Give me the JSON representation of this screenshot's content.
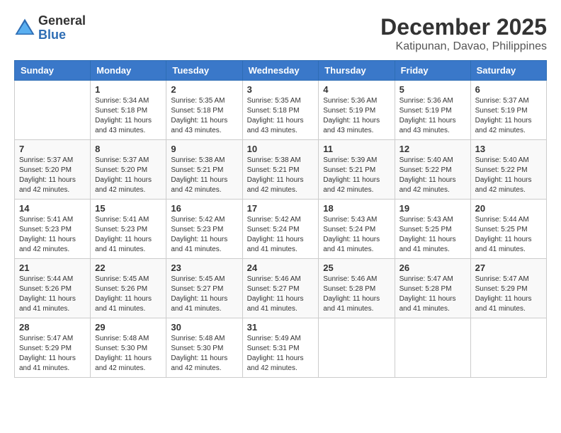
{
  "header": {
    "logo_general": "General",
    "logo_blue": "Blue",
    "month_year": "December 2025",
    "location": "Katipunan, Davao, Philippines"
  },
  "days_of_week": [
    "Sunday",
    "Monday",
    "Tuesday",
    "Wednesday",
    "Thursday",
    "Friday",
    "Saturday"
  ],
  "weeks": [
    [
      {
        "day": "",
        "info": ""
      },
      {
        "day": "1",
        "info": "Sunrise: 5:34 AM\nSunset: 5:18 PM\nDaylight: 11 hours\nand 43 minutes."
      },
      {
        "day": "2",
        "info": "Sunrise: 5:35 AM\nSunset: 5:18 PM\nDaylight: 11 hours\nand 43 minutes."
      },
      {
        "day": "3",
        "info": "Sunrise: 5:35 AM\nSunset: 5:18 PM\nDaylight: 11 hours\nand 43 minutes."
      },
      {
        "day": "4",
        "info": "Sunrise: 5:36 AM\nSunset: 5:19 PM\nDaylight: 11 hours\nand 43 minutes."
      },
      {
        "day": "5",
        "info": "Sunrise: 5:36 AM\nSunset: 5:19 PM\nDaylight: 11 hours\nand 43 minutes."
      },
      {
        "day": "6",
        "info": "Sunrise: 5:37 AM\nSunset: 5:19 PM\nDaylight: 11 hours\nand 42 minutes."
      }
    ],
    [
      {
        "day": "7",
        "info": "Sunrise: 5:37 AM\nSunset: 5:20 PM\nDaylight: 11 hours\nand 42 minutes."
      },
      {
        "day": "8",
        "info": "Sunrise: 5:37 AM\nSunset: 5:20 PM\nDaylight: 11 hours\nand 42 minutes."
      },
      {
        "day": "9",
        "info": "Sunrise: 5:38 AM\nSunset: 5:21 PM\nDaylight: 11 hours\nand 42 minutes."
      },
      {
        "day": "10",
        "info": "Sunrise: 5:38 AM\nSunset: 5:21 PM\nDaylight: 11 hours\nand 42 minutes."
      },
      {
        "day": "11",
        "info": "Sunrise: 5:39 AM\nSunset: 5:21 PM\nDaylight: 11 hours\nand 42 minutes."
      },
      {
        "day": "12",
        "info": "Sunrise: 5:40 AM\nSunset: 5:22 PM\nDaylight: 11 hours\nand 42 minutes."
      },
      {
        "day": "13",
        "info": "Sunrise: 5:40 AM\nSunset: 5:22 PM\nDaylight: 11 hours\nand 42 minutes."
      }
    ],
    [
      {
        "day": "14",
        "info": "Sunrise: 5:41 AM\nSunset: 5:23 PM\nDaylight: 11 hours\nand 42 minutes."
      },
      {
        "day": "15",
        "info": "Sunrise: 5:41 AM\nSunset: 5:23 PM\nDaylight: 11 hours\nand 41 minutes."
      },
      {
        "day": "16",
        "info": "Sunrise: 5:42 AM\nSunset: 5:23 PM\nDaylight: 11 hours\nand 41 minutes."
      },
      {
        "day": "17",
        "info": "Sunrise: 5:42 AM\nSunset: 5:24 PM\nDaylight: 11 hours\nand 41 minutes."
      },
      {
        "day": "18",
        "info": "Sunrise: 5:43 AM\nSunset: 5:24 PM\nDaylight: 11 hours\nand 41 minutes."
      },
      {
        "day": "19",
        "info": "Sunrise: 5:43 AM\nSunset: 5:25 PM\nDaylight: 11 hours\nand 41 minutes."
      },
      {
        "day": "20",
        "info": "Sunrise: 5:44 AM\nSunset: 5:25 PM\nDaylight: 11 hours\nand 41 minutes."
      }
    ],
    [
      {
        "day": "21",
        "info": "Sunrise: 5:44 AM\nSunset: 5:26 PM\nDaylight: 11 hours\nand 41 minutes."
      },
      {
        "day": "22",
        "info": "Sunrise: 5:45 AM\nSunset: 5:26 PM\nDaylight: 11 hours\nand 41 minutes."
      },
      {
        "day": "23",
        "info": "Sunrise: 5:45 AM\nSunset: 5:27 PM\nDaylight: 11 hours\nand 41 minutes."
      },
      {
        "day": "24",
        "info": "Sunrise: 5:46 AM\nSunset: 5:27 PM\nDaylight: 11 hours\nand 41 minutes."
      },
      {
        "day": "25",
        "info": "Sunrise: 5:46 AM\nSunset: 5:28 PM\nDaylight: 11 hours\nand 41 minutes."
      },
      {
        "day": "26",
        "info": "Sunrise: 5:47 AM\nSunset: 5:28 PM\nDaylight: 11 hours\nand 41 minutes."
      },
      {
        "day": "27",
        "info": "Sunrise: 5:47 AM\nSunset: 5:29 PM\nDaylight: 11 hours\nand 41 minutes."
      }
    ],
    [
      {
        "day": "28",
        "info": "Sunrise: 5:47 AM\nSunset: 5:29 PM\nDaylight: 11 hours\nand 41 minutes."
      },
      {
        "day": "29",
        "info": "Sunrise: 5:48 AM\nSunset: 5:30 PM\nDaylight: 11 hours\nand 42 minutes."
      },
      {
        "day": "30",
        "info": "Sunrise: 5:48 AM\nSunset: 5:30 PM\nDaylight: 11 hours\nand 42 minutes."
      },
      {
        "day": "31",
        "info": "Sunrise: 5:49 AM\nSunset: 5:31 PM\nDaylight: 11 hours\nand 42 minutes."
      },
      {
        "day": "",
        "info": ""
      },
      {
        "day": "",
        "info": ""
      },
      {
        "day": "",
        "info": ""
      }
    ]
  ]
}
